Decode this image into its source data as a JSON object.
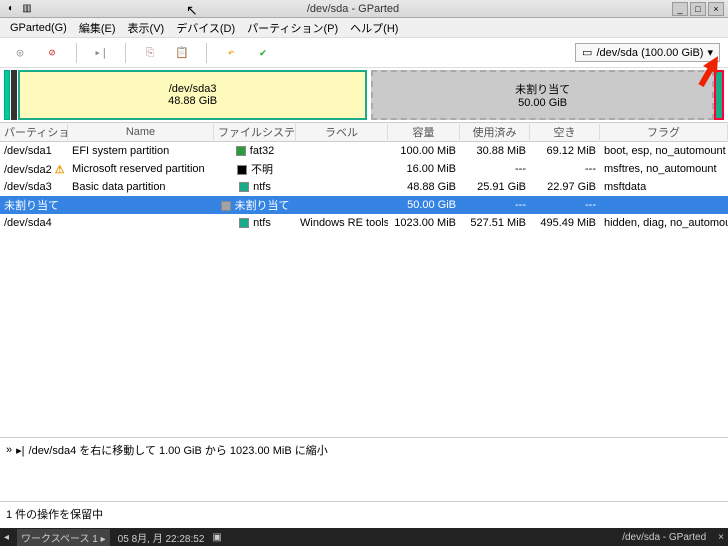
{
  "titlebar": {
    "title": "/dev/sda - GParted"
  },
  "menu": {
    "gparted": "GParted(G)",
    "edit": "編集(E)",
    "view": "表示(V)",
    "device": "デバイス(D)",
    "partition": "パーティション(P)",
    "help": "ヘルプ(H)"
  },
  "device_selector": {
    "label": "/dev/sda (100.00 GiB)"
  },
  "viz": {
    "sda3_name": "/dev/sda3",
    "sda3_size": "48.88 GiB",
    "unalloc_name": "未割り当て",
    "unalloc_size": "50.00 GiB"
  },
  "columns": {
    "partition": "パーティション",
    "name": "Name",
    "fs": "ファイルシステム",
    "label": "ラベル",
    "size": "容量",
    "used": "使用済み",
    "free": "空き",
    "flags": "フラグ"
  },
  "rows": [
    {
      "part": "/dev/sda1",
      "warn": false,
      "name": "EFI system partition",
      "swatch": "#2e9a3a",
      "fs": "fat32",
      "label": "",
      "size": "100.00 MiB",
      "used": "30.88 MiB",
      "free": "69.12 MiB",
      "flags": "boot, esp, no_automount"
    },
    {
      "part": "/dev/sda2",
      "warn": true,
      "name": "Microsoft reserved partition",
      "swatch": "#000000",
      "fs": "不明",
      "label": "",
      "size": "16.00 MiB",
      "used": "---",
      "free": "---",
      "flags": "msftres, no_automount"
    },
    {
      "part": "/dev/sda3",
      "warn": false,
      "name": "Basic data partition",
      "swatch": "#1aab8a",
      "fs": "ntfs",
      "label": "",
      "size": "48.88 GiB",
      "used": "25.91 GiB",
      "free": "22.97 GiB",
      "flags": "msftdata"
    },
    {
      "part": "未割り当て",
      "warn": false,
      "name": "",
      "swatch": "#a4a4a4",
      "fs": "未割り当て",
      "label": "",
      "size": "50.00 GiB",
      "used": "---",
      "free": "---",
      "flags": "",
      "selected": true
    },
    {
      "part": "/dev/sda4",
      "warn": false,
      "name": "",
      "swatch": "#1aab8a",
      "fs": "ntfs",
      "label": "Windows RE tools",
      "size": "1023.00 MiB",
      "used": "527.51 MiB",
      "free": "495.49 MiB",
      "flags": "hidden, diag, no_automount"
    }
  ],
  "operation": "/dev/sda4 を右に移動して 1.00 GiB から 1023.00 MiB に縮小",
  "pending": "1 件の操作を保留中",
  "taskbar": {
    "workspace": "ワークスペース 1 ▸",
    "date": "05 8月, 月 22:28:52",
    "title": "/dev/sda - GParted"
  }
}
